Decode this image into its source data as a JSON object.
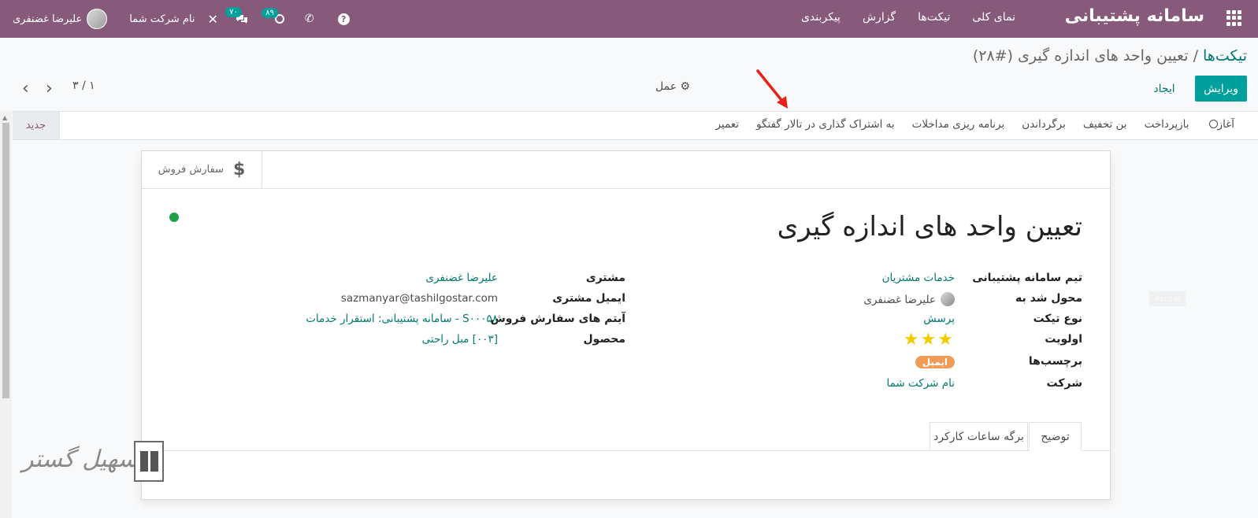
{
  "navbar": {
    "brand": "سامانه پشتیبانی",
    "menu": [
      "نمای کلی",
      "تیکت‌ها",
      "گزارش",
      "پیکربندی"
    ],
    "user_name": "علیرضا غضنفری",
    "company": "نام شرکت شما",
    "messages_count": "۷۰",
    "activities_count": "۸۹"
  },
  "breadcrumb": {
    "parent": "تیکت‌ها",
    "separator": "/",
    "current": "تعیین واحد های اندازه گیری (#۲۸)"
  },
  "controls": {
    "edit": "ویرایش",
    "create": "ایجاد",
    "action": "عمل",
    "pager": "۳ / ۱"
  },
  "actionbar": {
    "buttons": [
      "آغاز",
      "بازپرداخت",
      "بن تخفیف",
      "برگرداندن",
      "برنامه ریزی مداخلات",
      "به اشتراک گذاری در تالار گفتگو",
      "تعمیر"
    ],
    "stage_new": "جدید"
  },
  "smart_button": {
    "label": "سفارش فروش"
  },
  "ticket": {
    "title": "تعیین واحد های اندازه گیری",
    "left_fields": {
      "team_label": "تیم سامانه پشتیبانی",
      "team_value": "خدمات مشتریان",
      "assigned_label": "محول شد به",
      "assigned_value": "علیرضا غضنفری",
      "type_label": "نوع تیکت",
      "type_value": "پرسش",
      "priority_label": "اولویت",
      "priority_stars": 3,
      "tags_label": "برچسب‌ها",
      "tag_value": "ایمیل",
      "company_label": "شرکت",
      "company_value": "نام شرکت شما"
    },
    "right_fields": {
      "customer_label": "مشتری",
      "customer_value": "علیرضا غضنفری",
      "email_label": "ایمیل مشتری",
      "email_value": "sazmanyar@tashilgostar.com",
      "so_item_label": "آیتم های سفارش فروش",
      "so_item_value": "S۰۰۰۵۸ - سامانه پشتیبانی: استقرار خدمات",
      "product_label": "محصول",
      "product_value": "[۰۰۳] مبل راحتی"
    }
  },
  "tabs": {
    "description": "توضیح",
    "timesheets": "برگه ساعات کارکرد"
  },
  "ghost_label": "Arrow",
  "watermark": "تسهیل گستر",
  "colors": {
    "navbar": "#875a7b",
    "primary": "#00a09d",
    "link": "#01786f",
    "tag": "#f09c57",
    "star": "#f3cc00",
    "status_dot": "#21a04a",
    "arrow": "#e8201a"
  }
}
